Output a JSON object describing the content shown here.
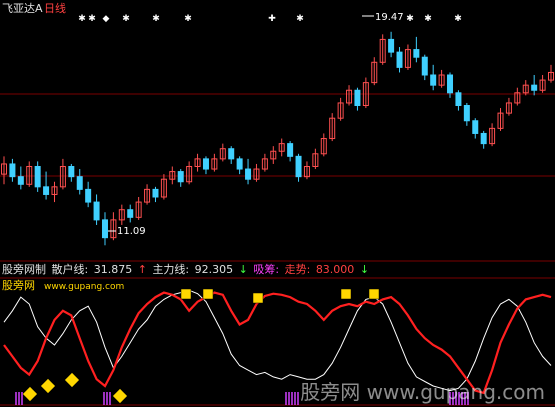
{
  "header": {
    "stock_name": "飞亚达A",
    "period": "日线"
  },
  "price_panel": {
    "high_marker": "19.47",
    "low_marker": "11.09"
  },
  "indicator_bar": {
    "name": "股旁网制",
    "retail_label": "散户线:",
    "retail_value": "31.875",
    "retail_arrow": "↑",
    "main_label": "主力线:",
    "main_value": "92.305",
    "main_arrow": "↓",
    "absorb_label": "吸筹:",
    "trend_label": "走势:",
    "trend_value": "83.000",
    "trend_arrow": "↓"
  },
  "site_label": "股旁网",
  "site_url": "www.gupang.com",
  "watermark": "股旁网 www.gupang.com",
  "chart_data": [
    {
      "type": "candlestick",
      "title": "飞亚达A 日线",
      "ylim": [
        10.6,
        20.2
      ],
      "annotations": [
        {
          "label": "19.47",
          "value": 19.47
        },
        {
          "label": "11.09",
          "value": 11.09
        }
      ],
      "colors": {
        "up": "#ff5050",
        "down": "#40d0ff"
      },
      "candles": [
        [
          13.9,
          14.6,
          13.5,
          14.3
        ],
        [
          14.3,
          14.5,
          13.6,
          13.8
        ],
        [
          13.8,
          14.2,
          13.3,
          13.5
        ],
        [
          13.5,
          14.4,
          13.4,
          14.2
        ],
        [
          14.2,
          14.4,
          13.2,
          13.4
        ],
        [
          13.4,
          14.0,
          12.9,
          13.1
        ],
        [
          13.1,
          13.6,
          12.8,
          13.4
        ],
        [
          13.4,
          14.5,
          13.3,
          14.2
        ],
        [
          14.2,
          14.3,
          13.6,
          13.8
        ],
        [
          13.8,
          14.1,
          13.1,
          13.3
        ],
        [
          13.3,
          13.6,
          12.6,
          12.8
        ],
        [
          12.8,
          13.1,
          11.9,
          12.1
        ],
        [
          12.1,
          12.4,
          11.1,
          11.4
        ],
        [
          11.4,
          12.4,
          11.3,
          12.1
        ],
        [
          12.1,
          12.7,
          11.9,
          12.5
        ],
        [
          12.5,
          12.7,
          12.0,
          12.2
        ],
        [
          12.2,
          13.0,
          12.1,
          12.8
        ],
        [
          12.8,
          13.5,
          12.7,
          13.3
        ],
        [
          13.3,
          13.4,
          12.8,
          13.0
        ],
        [
          13.0,
          13.9,
          12.9,
          13.7
        ],
        [
          13.7,
          14.2,
          13.5,
          14.0
        ],
        [
          14.0,
          14.1,
          13.4,
          13.6
        ],
        [
          13.6,
          14.4,
          13.5,
          14.2
        ],
        [
          14.2,
          14.7,
          14.0,
          14.5
        ],
        [
          14.5,
          14.6,
          13.9,
          14.1
        ],
        [
          14.1,
          14.7,
          14.0,
          14.5
        ],
        [
          14.5,
          15.1,
          14.4,
          14.9
        ],
        [
          14.9,
          15.0,
          14.3,
          14.5
        ],
        [
          14.5,
          14.6,
          13.9,
          14.1
        ],
        [
          14.1,
          14.5,
          13.5,
          13.7
        ],
        [
          13.7,
          14.3,
          13.6,
          14.1
        ],
        [
          14.1,
          14.7,
          14.0,
          14.5
        ],
        [
          14.5,
          15.0,
          14.3,
          14.8
        ],
        [
          14.8,
          15.3,
          14.6,
          15.1
        ],
        [
          15.1,
          15.2,
          14.4,
          14.6
        ],
        [
          14.6,
          14.7,
          13.6,
          13.8
        ],
        [
          13.8,
          14.4,
          13.7,
          14.2
        ],
        [
          14.2,
          14.9,
          14.1,
          14.7
        ],
        [
          14.7,
          15.5,
          14.6,
          15.3
        ],
        [
          15.3,
          16.3,
          15.2,
          16.1
        ],
        [
          16.1,
          16.9,
          16.0,
          16.7
        ],
        [
          16.7,
          17.4,
          16.6,
          17.2
        ],
        [
          17.2,
          17.3,
          16.4,
          16.6
        ],
        [
          16.6,
          17.7,
          16.5,
          17.5
        ],
        [
          17.5,
          18.5,
          17.4,
          18.3
        ],
        [
          18.3,
          19.4,
          18.2,
          19.2
        ],
        [
          19.2,
          19.5,
          18.5,
          18.7
        ],
        [
          18.7,
          18.9,
          17.9,
          18.1
        ],
        [
          18.1,
          19.0,
          18.0,
          18.8
        ],
        [
          18.8,
          19.3,
          18.3,
          18.5
        ],
        [
          18.5,
          18.6,
          17.6,
          17.8
        ],
        [
          17.8,
          18.2,
          17.2,
          17.4
        ],
        [
          17.4,
          18.0,
          17.3,
          17.8
        ],
        [
          17.8,
          17.9,
          16.9,
          17.1
        ],
        [
          17.1,
          17.2,
          16.4,
          16.6
        ],
        [
          16.6,
          16.7,
          15.8,
          16.0
        ],
        [
          16.0,
          16.1,
          15.3,
          15.5
        ],
        [
          15.5,
          15.6,
          14.9,
          15.1
        ],
        [
          15.1,
          15.9,
          15.0,
          15.7
        ],
        [
          15.7,
          16.5,
          15.6,
          16.3
        ],
        [
          16.3,
          16.9,
          16.2,
          16.7
        ],
        [
          16.7,
          17.3,
          16.6,
          17.1
        ],
        [
          17.1,
          17.6,
          17.0,
          17.4
        ],
        [
          17.4,
          17.8,
          17.0,
          17.2
        ],
        [
          17.2,
          17.8,
          17.1,
          17.6
        ],
        [
          17.6,
          18.2,
          17.5,
          17.9
        ]
      ]
    },
    {
      "type": "line",
      "title": "股旁网制",
      "ylim": [
        0,
        100
      ],
      "series": [
        {
          "name": "散户线",
          "color": "#ffffff",
          "last": 31.875,
          "values": [
            70,
            80,
            92,
            86,
            66,
            56,
            50,
            60,
            72,
            80,
            84,
            70,
            48,
            30,
            40,
            52,
            64,
            72,
            84,
            90,
            94,
            96,
            98,
            95,
            88,
            74,
            60,
            42,
            32,
            28,
            24,
            26,
            22,
            20,
            24,
            22,
            20,
            20,
            24,
            34,
            48,
            64,
            80,
            90,
            92,
            86,
            70,
            52,
            34,
            22,
            18,
            14,
            12,
            10,
            12,
            20,
            36,
            56,
            74,
            86,
            90,
            84,
            70,
            52,
            40,
            32
          ]
        },
        {
          "name": "主力线",
          "color": "#ff2020",
          "last": 92.305,
          "values": [
            50,
            40,
            30,
            24,
            36,
            56,
            72,
            80,
            76,
            56,
            36,
            20,
            14,
            28,
            48,
            64,
            78,
            86,
            92,
            96,
            94,
            90,
            80,
            88,
            92,
            96,
            94,
            80,
            68,
            72,
            86,
            93,
            95,
            94,
            92,
            88,
            86,
            80,
            72,
            80,
            84,
            86,
            84,
            88,
            86,
            90,
            92,
            86,
            76,
            64,
            56,
            50,
            46,
            40,
            30,
            20,
            10,
            8,
            28,
            52,
            68,
            82,
            90,
            92,
            94,
            92
          ]
        }
      ]
    }
  ]
}
